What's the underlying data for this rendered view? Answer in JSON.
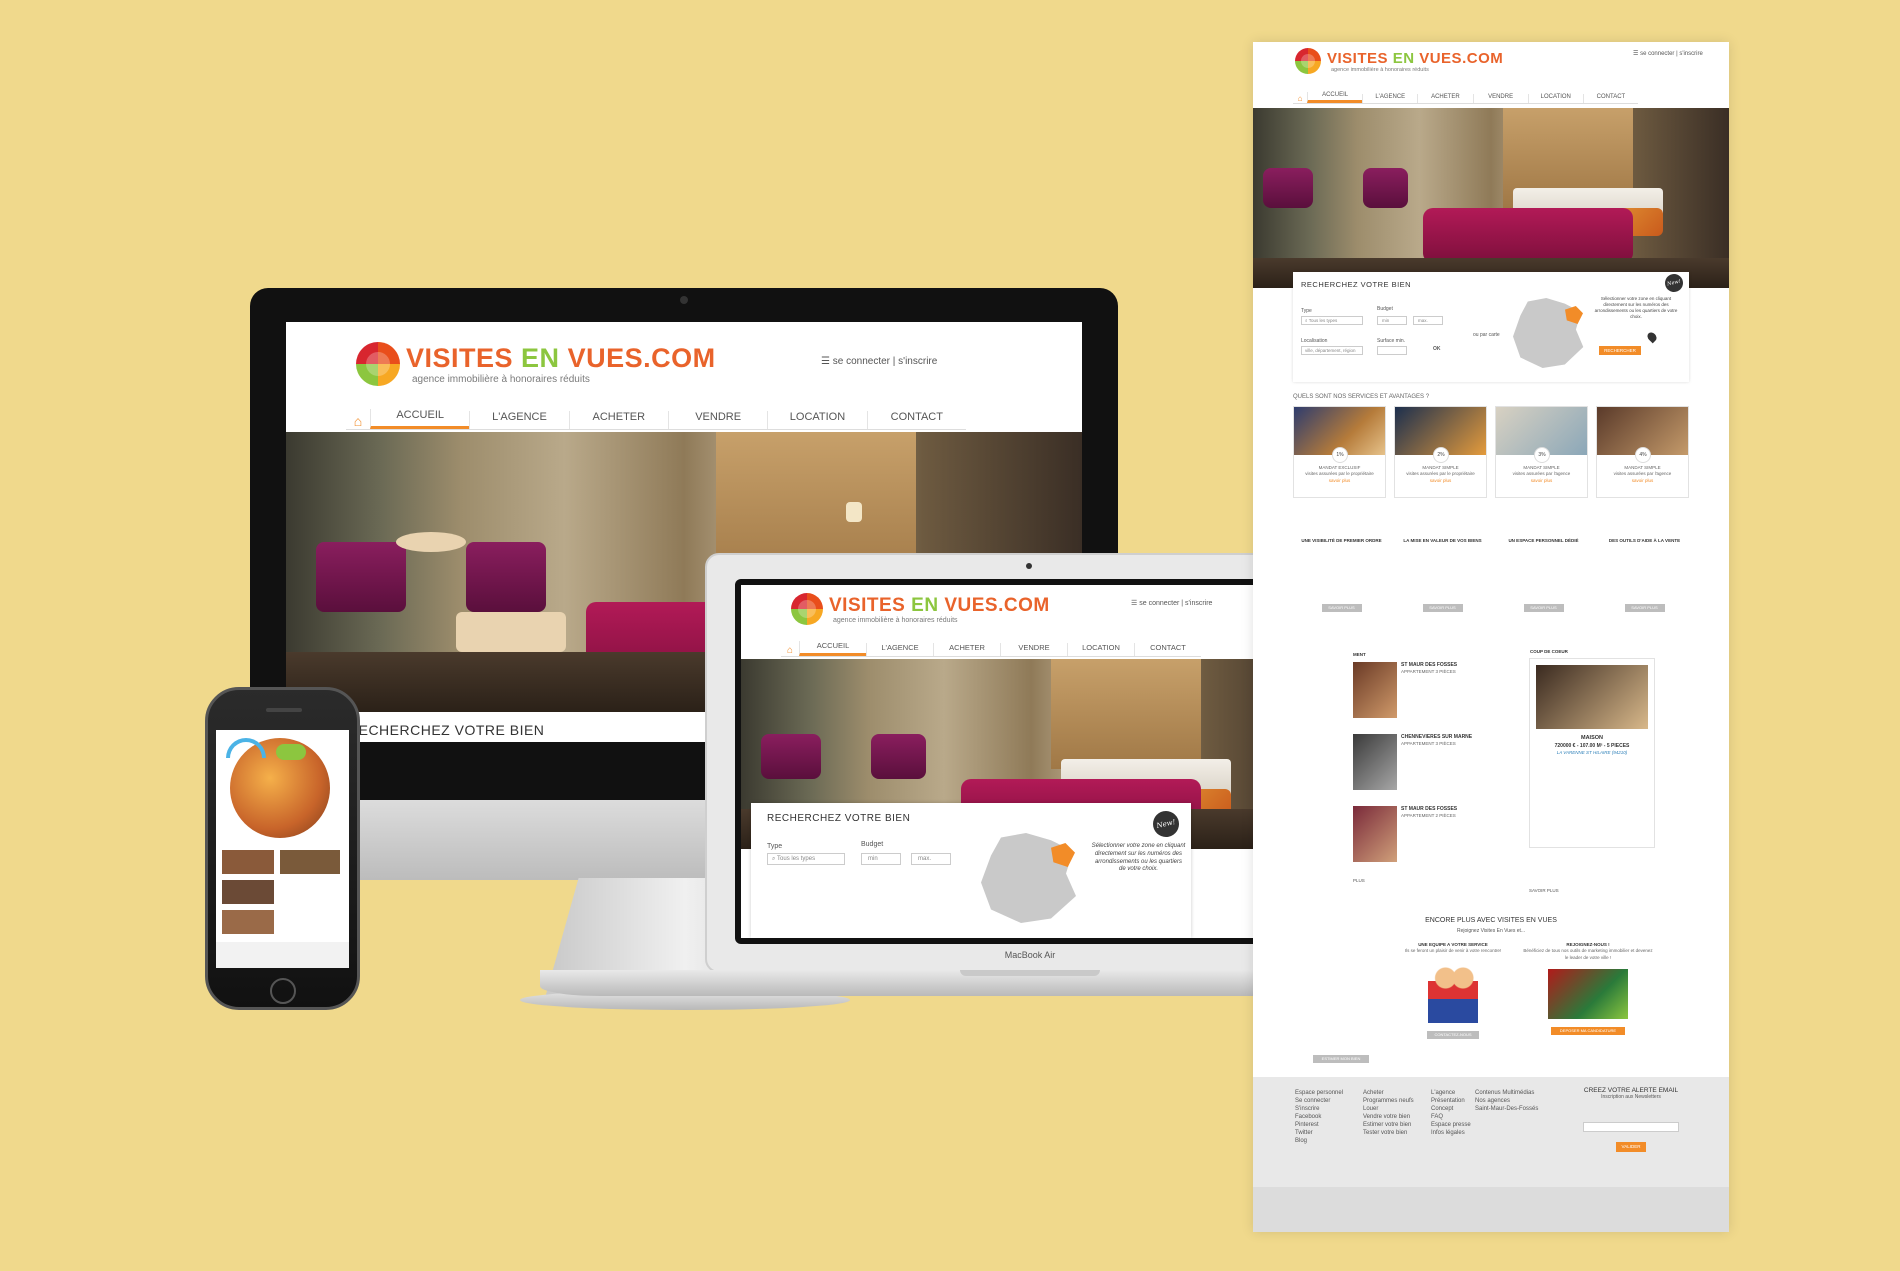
{
  "site": {
    "brand_part1": "VISITES",
    "brand_part2": "EN",
    "brand_part3": "VUES.COM",
    "tagline": "agence immobilière à honoraires réduits",
    "login": "se connecter",
    "signup": "s'inscrire",
    "nav": [
      "ACCUEIL",
      "L'AGENCE",
      "ACHETER",
      "VENDRE",
      "LOCATION",
      "CONTACT"
    ],
    "search_title": "RECHERCHEZ VOTRE BIEN",
    "type_label": "Type",
    "type_placeholder": "Tous les types",
    "budget_label": "Budget",
    "min_placeholder": "min",
    "max_placeholder": "max.",
    "new_badge": "New!",
    "map_hint": "Sélectionner votre zone en cliquant directement sur les numéros des arrondissements ou les quartiers de votre choix.",
    "localisation_label": "Localisation",
    "localisation_placeholder": "ville, département, région",
    "surface_label": "Surface min.",
    "ok": "OK",
    "or_by_map": "ou par carte",
    "search_button": "RECHERCHER"
  },
  "laptop": {
    "model": "MacBook Air"
  },
  "services": {
    "title": "QUELS SONT NOS SERVICES ET AVANTAGES ?",
    "cards": [
      {
        "pct": "1%",
        "name": "MANDAT EXCLUSIF",
        "desc": "visites assurées par le propriétaire",
        "more": "savoir plus"
      },
      {
        "pct": "2%",
        "name": "MANDAT SIMPLE",
        "desc": "visites assurées par le propriétaire",
        "more": "savoir plus"
      },
      {
        "pct": "3%",
        "name": "MANDAT SIMPLE",
        "desc": "visites assurées par l'agence",
        "more": "savoir plus"
      },
      {
        "pct": "4%",
        "name": "MANDAT SIMPLE",
        "desc": "visites assurées par l'agence",
        "more": "savoir plus"
      }
    ]
  },
  "features": [
    {
      "title": "UNE VISIBILITÉ DE PREMIER ORDRE",
      "more": "SAVOIR PLUS"
    },
    {
      "title": "LA MISE EN VALEUR DE VOS BIENS",
      "more": "SAVOIR PLUS"
    },
    {
      "title": "UN ESPACE PERSONNEL DÉDIÉ",
      "more": "SAVOIR PLUS"
    },
    {
      "title": "DES OUTILS D'AIDE À LA VENTE",
      "more": "SAVOIR PLUS"
    }
  ],
  "listings": {
    "header_fragment": "MENT",
    "items": [
      {
        "city": "ST MAUR DES FOSSES",
        "type": "APPARTEMENT 3 PIÈCES"
      },
      {
        "city": "CHENNEVIERES SUR MARNE",
        "type": "APPARTEMENT 3 PIÈCES"
      },
      {
        "city": "ST MAUR DES FOSSES",
        "type": "APPARTEMENT 2 PIÈCES"
      }
    ],
    "more": "PLUS"
  },
  "featured": {
    "title": "COUP DE COEUR",
    "kind": "MAISON",
    "price": "720000 € - 107.00 M² - 5 PIÈCES",
    "location": "LA VARENNE ST HILAIRE (94210)",
    "more": "SAVOIR PLUS"
  },
  "encore": {
    "title": "ENCORE PLUS AVEC VISITES EN VUES",
    "subtitle": "Rejoignez Visites En Vues et...",
    "cols": [
      {
        "title": "UNE EQUIPE A VOTRE SERVICE",
        "text": "Ils se feront un plaisir de venir à votre rencontre!",
        "btn": "CONTACTEZ-NOUS"
      },
      {
        "title": "REJOIGNEZ-NOUS !",
        "text": "Bénéficiez de tous nos outils de marketing immobilier et devenez le leader de votre ville !",
        "btn": "DEPOSER MA CANDIDATURE"
      }
    ],
    "left_btn": "ESTIMER MON BIEN"
  },
  "footer": {
    "col1": [
      "Espace personnel",
      "Se connecter",
      "S'inscrire",
      "Facebook",
      "Pinterest",
      "Twitter",
      "Blog"
    ],
    "col2": [
      "Acheter",
      "Programmes neufs",
      "Louer",
      "Vendre votre bien",
      "Estimer votre bien",
      "Tester votre bien"
    ],
    "col3": [
      "L'agence",
      "Présentation",
      "Concept",
      "FAQ",
      "Espace presse",
      "Infos légales"
    ],
    "col4": [
      "Contenus Multimédias",
      "Nos agences",
      "Saint-Maur-Des-Fossés"
    ],
    "alert_title": "CREEZ VOTRE ALERTE EMAIL",
    "alert_sub": "Inscription aux Newsletters",
    "alert_btn": "VALIDER"
  },
  "colors": {
    "accent": "#f28c28",
    "background": "#f0d98c"
  }
}
